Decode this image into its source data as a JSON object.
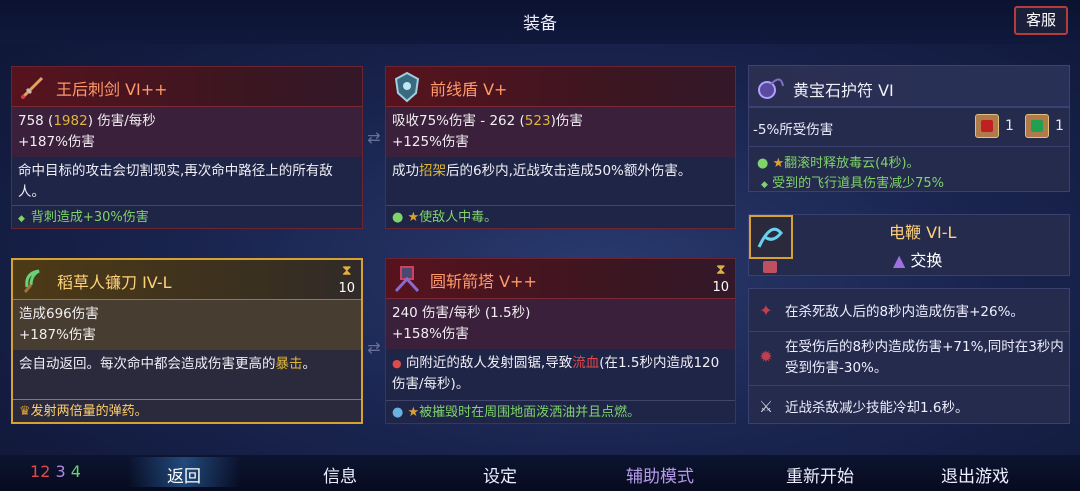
{
  "header": {
    "title": "装备",
    "customer_service": "客服"
  },
  "cards": {
    "c1": {
      "name": "王后刺剑 VI++",
      "stats": [
        "758 (",
        "1982",
        ") 伤害/每秒",
        "+187%伤害"
      ],
      "desc": "命中目标的攻击会切割现实,再次命中路径上的所有敌人。",
      "note_icon": "◆",
      "note": "背刺造成+30%伤害"
    },
    "c2": {
      "name": "前线盾 V+",
      "stats_line1a": "吸收75%伤害 - 262 (",
      "stats_line1b": "523",
      "stats_line1c": ")伤害",
      "stats_line2": "+125%伤害",
      "desc_a": "成功",
      "desc_b": "招架",
      "desc_c": "后的6秒内,近战攻击造成50%额外伤害。",
      "note": "使敌人中毒。"
    },
    "c3": {
      "name": "稻草人镰刀 IV-L",
      "timer": "10",
      "stats_line1": "造成696伤害",
      "stats_line2": "+187%伤害",
      "desc_a": "会自动返回。每次命中都会造成伤害更高的",
      "desc_b": "暴击",
      "desc_c": "。",
      "note": "发射两倍量的弹药。"
    },
    "c4": {
      "name": "圆斩箭塔 V++",
      "timer": "10",
      "stats_line1": "240 伤害/每秒 (1.5秒)",
      "stats_line2": "+158%伤害",
      "desc_a": "向附近的敌人发射圆锯,导致",
      "desc_b": "流血",
      "desc_c": "(在1.5秒内造成120伤害/每秒)。",
      "note": "被摧毁时在周围地面泼洒油并且点燃。"
    }
  },
  "amulet": {
    "name": "黄宝石护符 VI",
    "stat": "-5%所受伤害",
    "scroll1_count": "1",
    "scroll2_count": "1",
    "line1": "翻滚时释放毒云(4秒)。",
    "line2": "受到的飞行道具伤害减少75%"
  },
  "weapon_swap": {
    "name": "电鞭 VI-L",
    "action": "交换"
  },
  "mutations": [
    "在杀死敌人后的8秒内造成伤害+26%。",
    "在受伤后的8秒内造成伤害+71%,同时在3秒内受到伤害-30%。",
    "近战杀敌减少技能冷却1.6秒。"
  ],
  "bottom": {
    "stats": [
      "1",
      "2",
      "3",
      "4"
    ],
    "menu": [
      "返回",
      "信息",
      "设定",
      "辅助模式",
      "重新开始",
      "退出游戏"
    ]
  },
  "colors": {
    "accent_red": "#6c2530",
    "gold": "#d8a232",
    "green": "#7fd36a",
    "purple": "#b59ae8"
  }
}
